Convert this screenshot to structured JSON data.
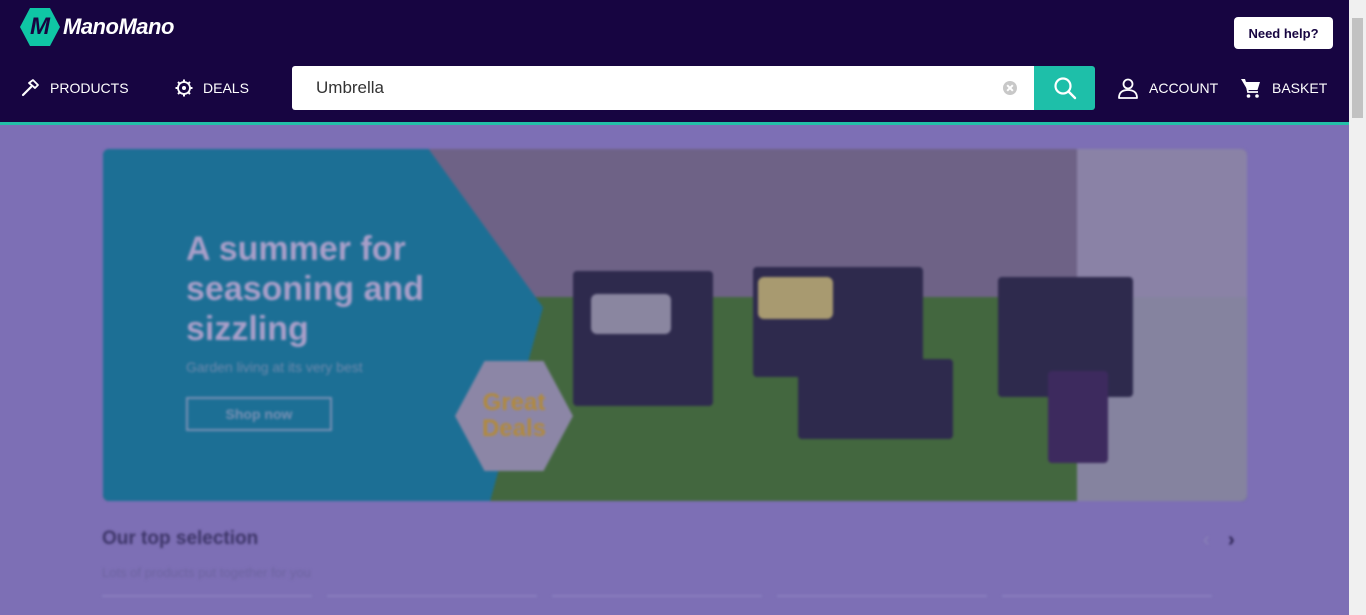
{
  "header": {
    "logo_letter": "M",
    "logo_text": "ManoMano",
    "help_label": "Need help?",
    "nav": {
      "products_label": "PRODUCTS",
      "deals_label": "DEALS",
      "account_label": "ACCOUNT",
      "basket_label": "BASKET"
    },
    "search": {
      "value": "Umbrella"
    }
  },
  "banner": {
    "title": "A summer for seasoning and sizzling",
    "subtitle": "Garden living at its very best",
    "cta_label": "Shop now",
    "deal_badge_line1": "Great",
    "deal_badge_line2": "Deals"
  },
  "top_selection": {
    "title": "Our top selection",
    "subtitle": "Lots of products put together for you"
  },
  "colors": {
    "header_bg": "#170541",
    "accent_teal": "#1ebfa9",
    "overlay": "#7d6fb5"
  },
  "icons": {
    "products": "hammer-icon",
    "deals": "gear-badge-icon",
    "search": "search-icon",
    "clear": "clear-icon",
    "account": "user-icon",
    "basket": "cart-icon"
  }
}
